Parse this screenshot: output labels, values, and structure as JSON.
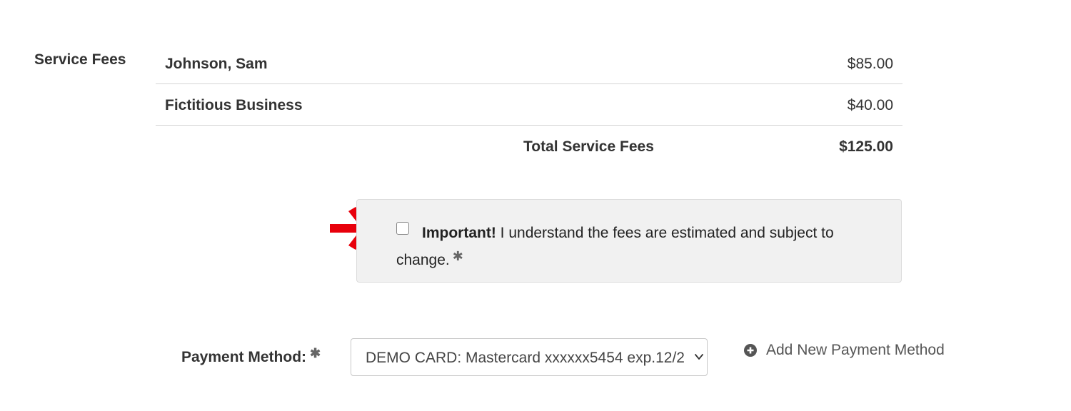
{
  "service_fees": {
    "label": "Service Fees",
    "items": [
      {
        "name": "Johnson, Sam",
        "amount": "$85.00"
      },
      {
        "name": "Fictitious Business",
        "amount": "$40.00"
      }
    ],
    "total_label": "Total Service Fees",
    "total_amount": "$125.00"
  },
  "acknowledgement": {
    "important": "Important!",
    "text": " I understand the fees are estimated and subject to change.",
    "checked": false,
    "required_mark": "✱",
    "arrow_color": "#e8000b"
  },
  "payment": {
    "label": "Payment Method:",
    "required_mark": "✱",
    "selected": "DEMO CARD: Mastercard xxxxxx5454 exp.12/2",
    "add_label": "Add New Payment Method"
  }
}
